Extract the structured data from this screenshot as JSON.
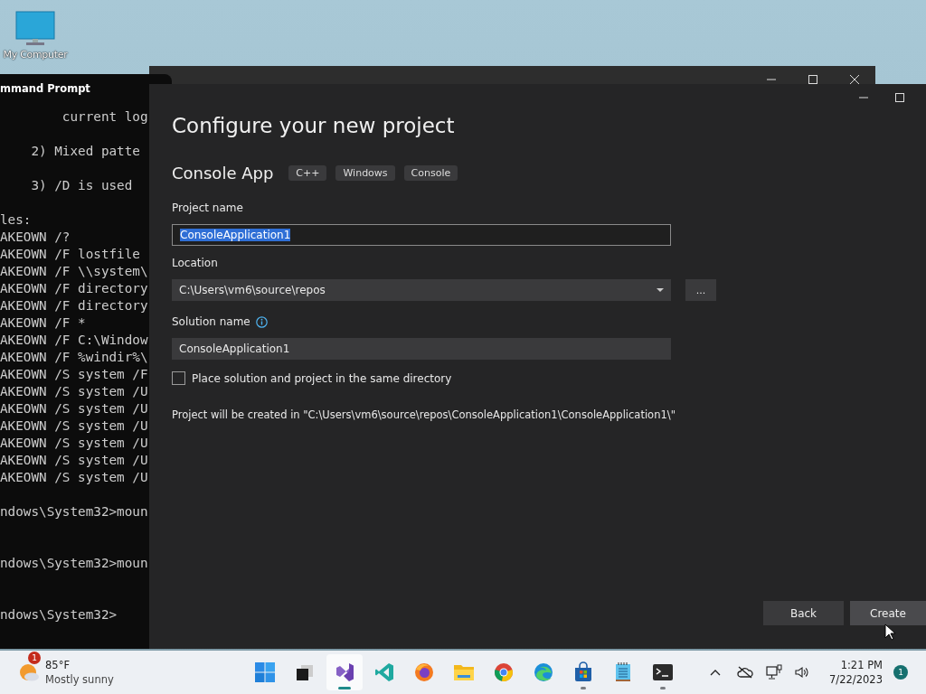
{
  "desktop_icons": [
    {
      "label": "My Computer"
    }
  ],
  "cmd_window": {
    "title": "mmand Prompt",
    "lines": [
      {
        "text": "        current log",
        "kind": "line"
      },
      {
        "text": "    2) Mixed patte",
        "kind": "gap"
      },
      {
        "text": "    3) /D is used",
        "kind": "gap"
      },
      {
        "text": "les:",
        "kind": "gap"
      },
      {
        "text": "AKEOWN /?",
        "kind": "line"
      },
      {
        "text": "AKEOWN /F lostfile",
        "kind": "line"
      },
      {
        "text": "AKEOWN /F \\\\system\\",
        "kind": "line"
      },
      {
        "text": "AKEOWN /F directory",
        "kind": "line"
      },
      {
        "text": "AKEOWN /F directory",
        "kind": "line"
      },
      {
        "text": "AKEOWN /F *",
        "kind": "line"
      },
      {
        "text": "AKEOWN /F C:\\Window",
        "kind": "line"
      },
      {
        "text": "AKEOWN /F %windir%\\",
        "kind": "line"
      },
      {
        "text": "AKEOWN /S system /F",
        "kind": "line"
      },
      {
        "text": "AKEOWN /S system /U",
        "kind": "line"
      },
      {
        "text": "AKEOWN /S system /U",
        "kind": "line"
      },
      {
        "text": "AKEOWN /S system /U",
        "kind": "line"
      },
      {
        "text": "AKEOWN /S system /U",
        "kind": "line"
      },
      {
        "text": "AKEOWN /S system /U",
        "kind": "line"
      },
      {
        "text": "AKEOWN /S system /U",
        "kind": "line"
      },
      {
        "text": "ndows\\System32>moun",
        "kind": "gap"
      },
      {
        "text": "ndows\\System32>moun",
        "kind": "double_gap"
      },
      {
        "text": "ndows\\System32>",
        "kind": "double_gap"
      }
    ]
  },
  "dialog": {
    "title": "Configure your new project",
    "project_type": "Console App",
    "tags": [
      "C++",
      "Windows",
      "Console"
    ],
    "project_name": {
      "label": "Project name",
      "value": "ConsoleApplication1",
      "value_selected": true
    },
    "location": {
      "label": "Location",
      "value": "C:\\Users\\vm6\\source\\repos",
      "browse_label": "..."
    },
    "solution_name": {
      "label": "Solution name",
      "value": "ConsoleApplication1"
    },
    "same_directory": {
      "label": "Place solution and project in the same directory",
      "checked": false
    },
    "path_note": "Project will be created in \"C:\\Users\\vm6\\source\\repos\\ConsoleApplication1\\ConsoleApplication1\\\"",
    "buttons": [
      {
        "label": "Back",
        "kind": "secondary"
      },
      {
        "label": "Create",
        "kind": "primary"
      }
    ]
  },
  "taskbar": {
    "weather": {
      "badge": "1",
      "temperature": "85°F",
      "condition": "Mostly sunny"
    },
    "apps": [
      {
        "kind": "start",
        "running": false,
        "selected": false
      },
      {
        "kind": "taskview",
        "running": false,
        "selected": false
      },
      {
        "kind": "vs",
        "running": true,
        "selected": true
      },
      {
        "kind": "vscode",
        "running": false,
        "selected": false
      },
      {
        "kind": "firefox",
        "running": false,
        "selected": false
      },
      {
        "kind": "explorer",
        "running": false,
        "selected": false
      },
      {
        "kind": "chrome",
        "running": false,
        "selected": false
      },
      {
        "kind": "edge",
        "running": false,
        "selected": false
      },
      {
        "kind": "store",
        "running": true,
        "selected": false
      },
      {
        "kind": "notepad",
        "running": false,
        "selected": false
      },
      {
        "kind": "terminal",
        "running": true,
        "selected": false
      }
    ],
    "time": "1:21 PM",
    "date": "7/22/2023",
    "notification_count": "1"
  }
}
